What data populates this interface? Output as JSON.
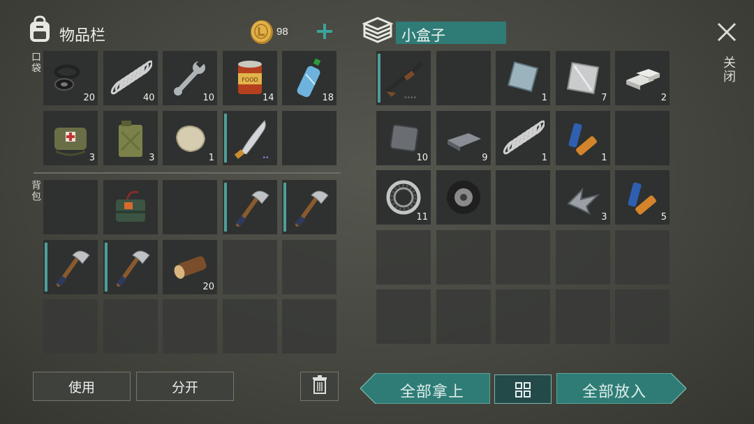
{
  "inventory": {
    "title": "物品栏",
    "coins": "98",
    "pocket_label": "口袋",
    "backpack_label": "背包",
    "pocket_items": [
      {
        "icon": "washer-ring-icon",
        "count": "20"
      },
      {
        "icon": "spring-icon",
        "count": "40"
      },
      {
        "icon": "wrench-icon",
        "count": "10"
      },
      {
        "icon": "canned-food-icon",
        "count": "14"
      },
      {
        "icon": "water-bottle-icon",
        "count": "18"
      },
      {
        "icon": "first-aid-bag-icon",
        "count": "3"
      },
      {
        "icon": "jerrycan-icon",
        "count": "3"
      },
      {
        "icon": "stone-icon",
        "count": "1"
      },
      {
        "icon": "machete-icon",
        "count": ""
      },
      {
        "icon": "",
        "count": ""
      }
    ],
    "backpack_items": [
      {
        "icon": "",
        "count": ""
      },
      {
        "icon": "explosive-box-icon",
        "count": ""
      },
      {
        "icon": "",
        "count": ""
      },
      {
        "icon": "hatchet-icon",
        "count": ""
      },
      {
        "icon": "hatchet-icon",
        "count": ""
      },
      {
        "icon": "hatchet-icon",
        "count": ""
      },
      {
        "icon": "hatchet-icon",
        "count": ""
      },
      {
        "icon": "log-icon",
        "count": "20"
      }
    ],
    "use_button": "使用",
    "split_button": "分开"
  },
  "container": {
    "title": "小盒子",
    "close_label": "关闭",
    "items": [
      {
        "icon": "shotgun-icon",
        "count": ""
      },
      {
        "icon": "",
        "count": ""
      },
      {
        "icon": "glass-sheet-icon",
        "count": "1"
      },
      {
        "icon": "metal-sheet-icon",
        "count": "7"
      },
      {
        "icon": "metal-ingot-icon",
        "count": "2"
      },
      {
        "icon": "iron-plate-icon",
        "count": "10"
      },
      {
        "icon": "iron-bar-icon",
        "count": "9"
      },
      {
        "icon": "spring-icon",
        "count": "1"
      },
      {
        "icon": "battery-icon",
        "count": "1"
      },
      {
        "icon": "",
        "count": ""
      },
      {
        "icon": "bearing-icon",
        "count": "11"
      },
      {
        "icon": "tire-icon",
        "count": ""
      },
      {
        "icon": "",
        "count": ""
      },
      {
        "icon": "scrap-metal-icon",
        "count": "3"
      },
      {
        "icon": "battery-icon",
        "count": "5"
      }
    ],
    "take_all_button": "全部拿上",
    "put_all_button": "全部放入"
  },
  "colors": {
    "teal": "#2f7c76",
    "coin": "#d9a63a",
    "durability": "#4f9e99"
  }
}
